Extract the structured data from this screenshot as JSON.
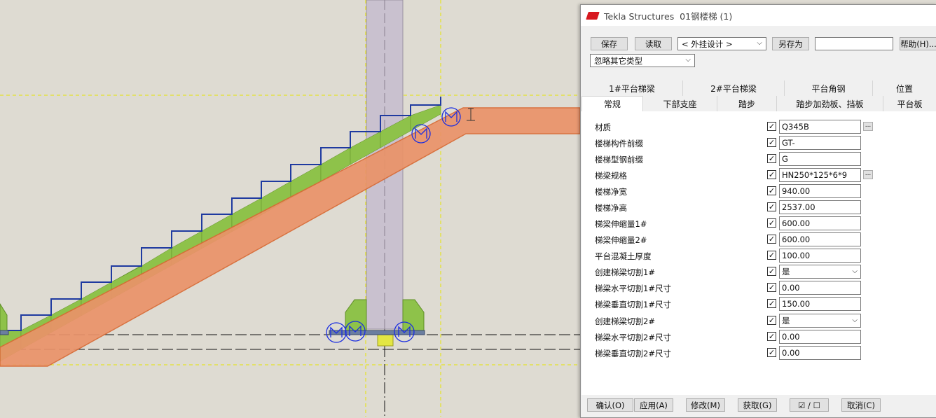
{
  "window": {
    "app": "Tekla Structures",
    "title": "01钢楼梯 (1)"
  },
  "toolbar": {
    "save": "保存",
    "load": "读取",
    "save_as": "另存为",
    "help": "帮助(H)...",
    "preset": "< 外挂设计 >",
    "save_as_name": "",
    "filter": "忽略其它类型"
  },
  "tabs_back": [
    "1#平台梯梁",
    "2#平台梯梁",
    "平台角钢",
    "位置"
  ],
  "tabs_front": [
    "常规",
    "下部支座",
    "踏步",
    "踏步加劲板、挡板",
    "平台板"
  ],
  "active_tab": "常规",
  "fields": [
    {
      "label": "材质",
      "value": "Q345B",
      "checked": true,
      "more": true
    },
    {
      "label": "楼梯构件前缀",
      "value": "GT-",
      "checked": true
    },
    {
      "label": "楼梯型钢前缀",
      "value": "G",
      "checked": true
    },
    {
      "label": "梯梁规格",
      "value": "HN250*125*6*9",
      "checked": true,
      "more": true
    },
    {
      "label": "楼梯净宽",
      "value": "940.00",
      "checked": true
    },
    {
      "label": "楼梯净高",
      "value": "2537.00",
      "checked": true
    },
    {
      "label": "梯梁伸缩量1#",
      "value": "600.00",
      "checked": true
    },
    {
      "label": "梯梁伸缩量2#",
      "value": "600.00",
      "checked": true
    },
    {
      "label": "平台混凝土厚度",
      "value": "100.00",
      "checked": true
    },
    {
      "label": "创建梯梁切割1#",
      "value": "是",
      "checked": true,
      "dropdown": true
    },
    {
      "label": "梯梁水平切割1#尺寸",
      "value": "0.00",
      "checked": true
    },
    {
      "label": "梯梁垂直切割1#尺寸",
      "value": "150.00",
      "checked": true
    },
    {
      "label": "创建梯梁切割2#",
      "value": "是",
      "checked": true,
      "dropdown": true
    },
    {
      "label": "梯梁水平切割2#尺寸",
      "value": "0.00",
      "checked": true
    },
    {
      "label": "梯梁垂直切割2#尺寸",
      "value": "0.00",
      "checked": true
    }
  ],
  "bottom": {
    "ok": "确认(O)",
    "apply": "应用(A)",
    "modify": "修改(M)",
    "get": "获取(G)",
    "toggle": "☑ / ☐",
    "cancel": "取消(C)"
  },
  "colors": {
    "stringer": "#ea9369",
    "stringer_edge": "#d86a34",
    "step_fill": "#8ec24a",
    "step_line": "#1f3aa0",
    "column": "#c9c1cf",
    "bolt": "#1a2de0"
  }
}
